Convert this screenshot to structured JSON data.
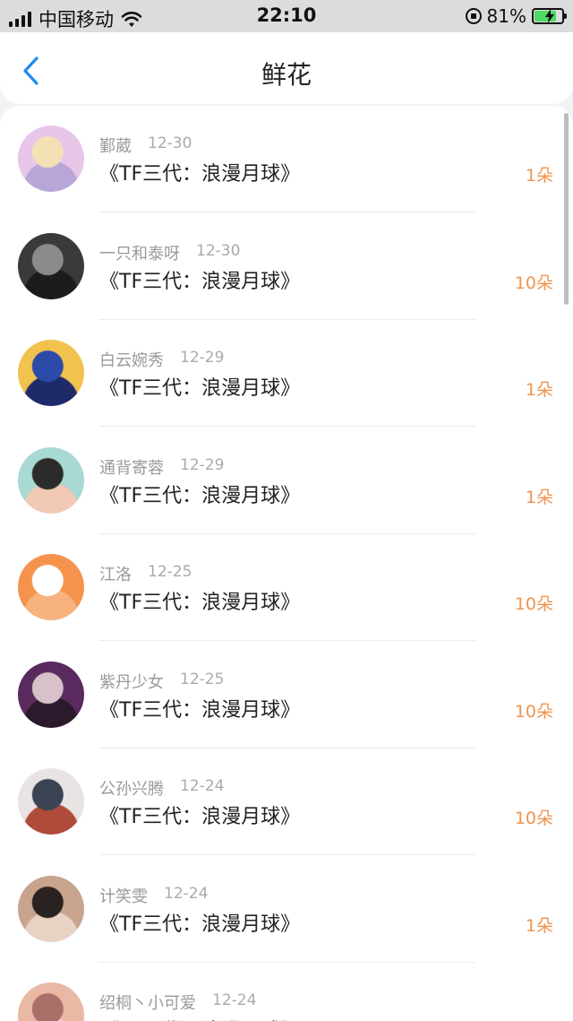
{
  "status_bar": {
    "carrier": "中国移动",
    "time": "22:10",
    "battery_percent": "81%",
    "battery_level": 0.81,
    "icons": [
      "signal-icon",
      "wifi-icon",
      "orientation-lock-icon",
      "battery-charging-icon"
    ]
  },
  "nav": {
    "title": "鲜花",
    "back_icon": "chevron-left-icon",
    "accent_color": "#1e8cf0"
  },
  "colors": {
    "count": "#f0954f",
    "meta": "#9a9a9a"
  },
  "rows": [
    {
      "name": "鄞葳",
      "date": "12-30",
      "book": "《TF三代：浪漫月球》",
      "count": "1朵",
      "avatar_colors": [
        "#e8c6ea",
        "#f3e1b5",
        "#b9a6d8"
      ]
    },
    {
      "name": "一只和泰呀",
      "date": "12-30",
      "book": "《TF三代：浪漫月球》",
      "count": "10朵",
      "avatar_colors": [
        "#3a3a3a",
        "#8b8b8b",
        "#1c1c1c"
      ]
    },
    {
      "name": "白云婉秀",
      "date": "12-29",
      "book": "《TF三代：浪漫月球》",
      "count": "1朵",
      "avatar_colors": [
        "#f2c24e",
        "#2c4aa8",
        "#1f2a6b"
      ]
    },
    {
      "name": "通背寄蓉",
      "date": "12-29",
      "book": "《TF三代：浪漫月球》",
      "count": "1朵",
      "avatar_colors": [
        "#a8d9d3",
        "#2b2b2b",
        "#f1c9b4"
      ]
    },
    {
      "name": "江洛",
      "date": "12-25",
      "book": "《TF三代：浪漫月球》",
      "count": "10朵",
      "avatar_colors": [
        "#f5934d",
        "#ffffff",
        "#f7b27d"
      ]
    },
    {
      "name": "紫丹少女",
      "date": "12-25",
      "book": "《TF三代：浪漫月球》",
      "count": "10朵",
      "avatar_colors": [
        "#5a2a5e",
        "#d6c2c8",
        "#2a1a2c"
      ]
    },
    {
      "name": "公孙兴腾",
      "date": "12-24",
      "book": "《TF三代：浪漫月球》",
      "count": "10朵",
      "avatar_colors": [
        "#e9e4e4",
        "#3b4453",
        "#b04a3a"
      ]
    },
    {
      "name": "计笑雯",
      "date": "12-24",
      "book": "《TF三代：浪漫月球》",
      "count": "1朵",
      "avatar_colors": [
        "#c8a48f",
        "#2a2220",
        "#e8d2c4"
      ]
    },
    {
      "name": "绍桐丶小可爱",
      "date": "12-24",
      "book": "《TF三代：浪漫月球》",
      "count": "",
      "avatar_colors": [
        "#e9b9a6",
        "#a9706a",
        "#f4d4c6"
      ]
    }
  ]
}
